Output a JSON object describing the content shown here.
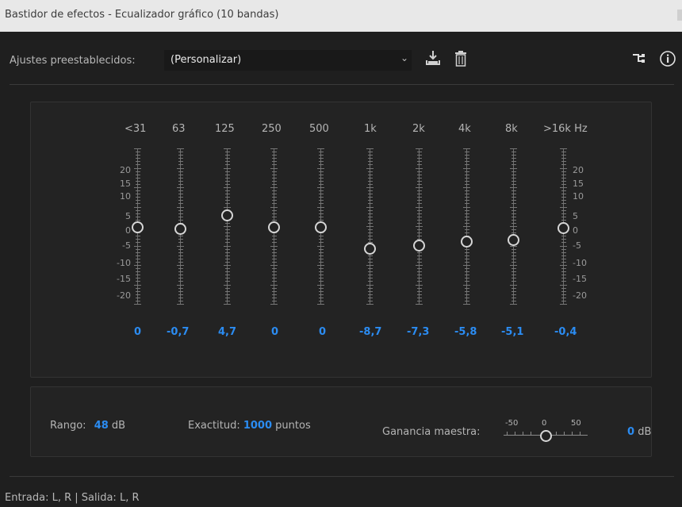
{
  "window": {
    "title": "Bastidor de efectos - Ecualizador gráfico (10 bandas)"
  },
  "presets": {
    "label": "Ajustes preestablecidos:",
    "value": "(Personalizar)"
  },
  "icons": [
    "chevron-down-icon",
    "download-icon",
    "trash-icon",
    "routing-icon",
    "info-icon"
  ],
  "eq": {
    "bands": [
      {
        "label": "<31",
        "value_text": "0",
        "gain_db": 0
      },
      {
        "label": "63",
        "value_text": "-0,7",
        "gain_db": -0.7
      },
      {
        "label": "125",
        "value_text": "4,7",
        "gain_db": 4.7
      },
      {
        "label": "250",
        "value_text": "0",
        "gain_db": 0
      },
      {
        "label": "500",
        "value_text": "0",
        "gain_db": 0
      },
      {
        "label": "1k",
        "value_text": "-8,7",
        "gain_db": -8.7
      },
      {
        "label": "2k",
        "value_text": "-7,3",
        "gain_db": -7.3
      },
      {
        "label": "4k",
        "value_text": "-5,8",
        "gain_db": -5.8
      },
      {
        "label": "8k",
        "value_text": "-5,1",
        "gain_db": -5.1
      },
      {
        "label": ">16k Hz",
        "value_text": "-0,4",
        "gain_db": -0.4
      }
    ],
    "scale_left": [
      "20",
      "15",
      "10",
      "5",
      "0",
      "-5",
      "-10",
      "-15",
      "-20"
    ],
    "scale_right": [
      "20",
      "15",
      "10",
      "5",
      "0",
      "-5",
      "-10",
      "-15",
      "-20"
    ],
    "scale_range_db": [
      -20,
      20
    ]
  },
  "settings": {
    "range_label": "Rango:",
    "range_value": "48",
    "range_unit": "dB",
    "accuracy_label": "Exactitud:",
    "accuracy_value": "1000",
    "accuracy_unit": "puntos",
    "gain_label": "Ganancia maestra:",
    "gain_min": "-50",
    "gain_mid": "0",
    "gain_max": "50",
    "gain_value": "0",
    "gain_unit": "dB",
    "gain_db": 0
  },
  "status": {
    "text": "Entrada: L, R | Salida: L, R"
  },
  "colors": {
    "accent": "#2b8cf2",
    "background": "#1f1f1f",
    "panel": "#232323"
  }
}
